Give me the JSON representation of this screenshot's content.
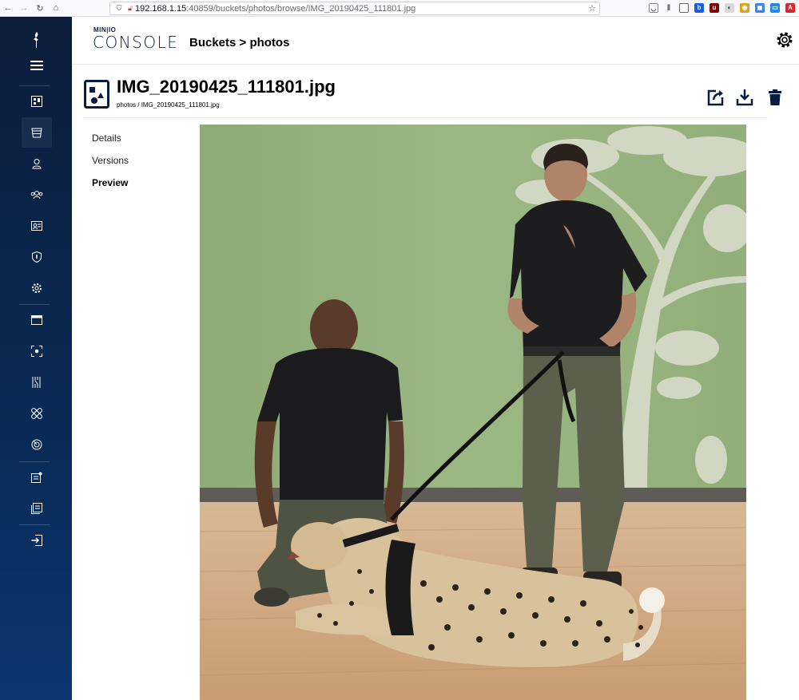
{
  "browser": {
    "url_host": "192.168.1.15",
    "url_rest": ":40859/buckets/photos/browse/IMG_20190425_111801.jpg"
  },
  "logo": {
    "top": "MIN|IO",
    "bottom": "CONSOLE"
  },
  "header": {
    "breadcrumb": "Buckets > photos"
  },
  "object": {
    "title": "IMG_20190425_111801.jpg",
    "path": "photos / IMG_20190425_111801.jpg"
  },
  "tabs": [
    {
      "label": "Details"
    },
    {
      "label": "Versions"
    },
    {
      "label": "Preview"
    }
  ],
  "sidebar": {
    "icons": [
      "minio-bird-icon",
      "menu-icon",
      "dashboard-icon",
      "buckets-icon",
      "user-icon",
      "groups-icon",
      "service-account-icon",
      "policy-icon",
      "settings-icon",
      "tenants-icon",
      "watch-icon",
      "trace-icon",
      "heal-icon",
      "health-icon",
      "logs-icon",
      "documentation-icon",
      "logout-icon"
    ]
  },
  "colors": {
    "sidebar": "#0b2a55",
    "text": "#000000",
    "image_wall": "#97b27d",
    "image_floor": "#d9b896"
  }
}
